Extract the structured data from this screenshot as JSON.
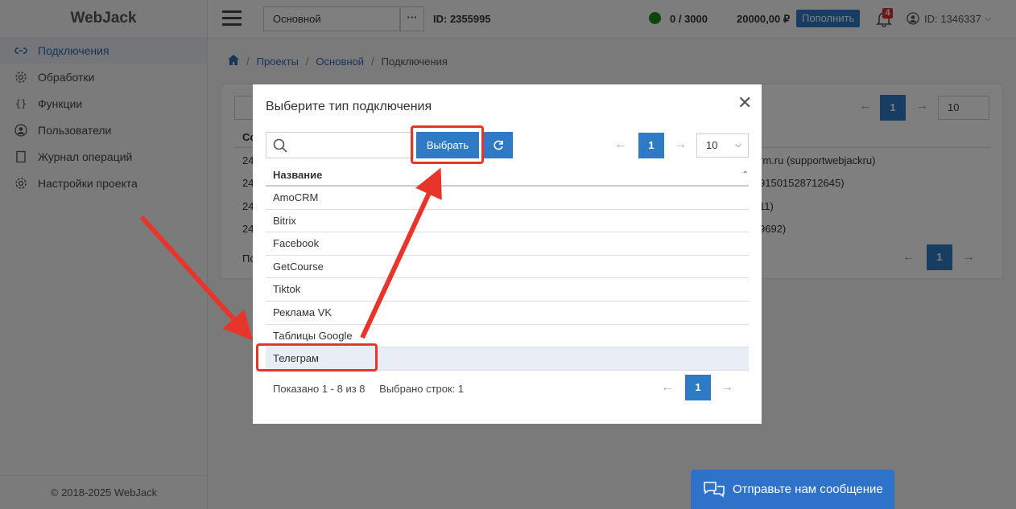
{
  "app": {
    "logo": "WebJack",
    "footer": "© 2018-2025 WebJack"
  },
  "sidebar": {
    "items": [
      {
        "label": "Подключения",
        "icon": "link-icon",
        "active": true
      },
      {
        "label": "Обработки",
        "icon": "gear-icon"
      },
      {
        "label": "Функции",
        "icon": "braces-icon"
      },
      {
        "label": "Пользователи",
        "icon": "user-circle-icon"
      },
      {
        "label": "Журнал операций",
        "icon": "journal-icon"
      },
      {
        "label": "Настройки проекта",
        "icon": "settings-icon"
      }
    ]
  },
  "topbar": {
    "project_select": "Основной",
    "more_button": "···",
    "project_id": "ID: 2355995",
    "counter": "0 / 3000",
    "balance": "20000,00 ₽",
    "topup_label": "Пополнить",
    "notifications_count": "4",
    "user_id": "ID: 1346337",
    "status_color": "#1a8a1a"
  },
  "breadcrumb": {
    "items": [
      "Проекты",
      "Основной",
      "Подключения"
    ]
  },
  "background": {
    "page": "1",
    "page_size": "10",
    "header_cell": "Со",
    "rows": [
      {
        "id": "24",
        "tail": "rm.ru (supportwebjackru)"
      },
      {
        "id": "24",
        "tail": "91501528712645)"
      },
      {
        "id": "24",
        "tail": "11)"
      },
      {
        "id": "24",
        "tail": "9692)"
      }
    ],
    "footer_text": "По"
  },
  "modal": {
    "title": "Выберите тип подключения",
    "search_placeholder": "",
    "select_button": "Выбрать",
    "page": "1",
    "page_size": "10",
    "column_header": "Название",
    "rows": [
      "AmoCRM",
      "Bitrix",
      "Facebook",
      "GetCourse",
      "Tiktok",
      "Реклама VK",
      "Таблицы Google",
      "Телеграм"
    ],
    "selected_index": 7,
    "shown_text": "Показано 1 - 8 из 8",
    "selected_text": "Выбрано строк: 1"
  },
  "chat": {
    "label": "Отправьте нам сообщение"
  },
  "colors": {
    "accent": "#2f7ac4",
    "annotation": "#e8352c"
  }
}
